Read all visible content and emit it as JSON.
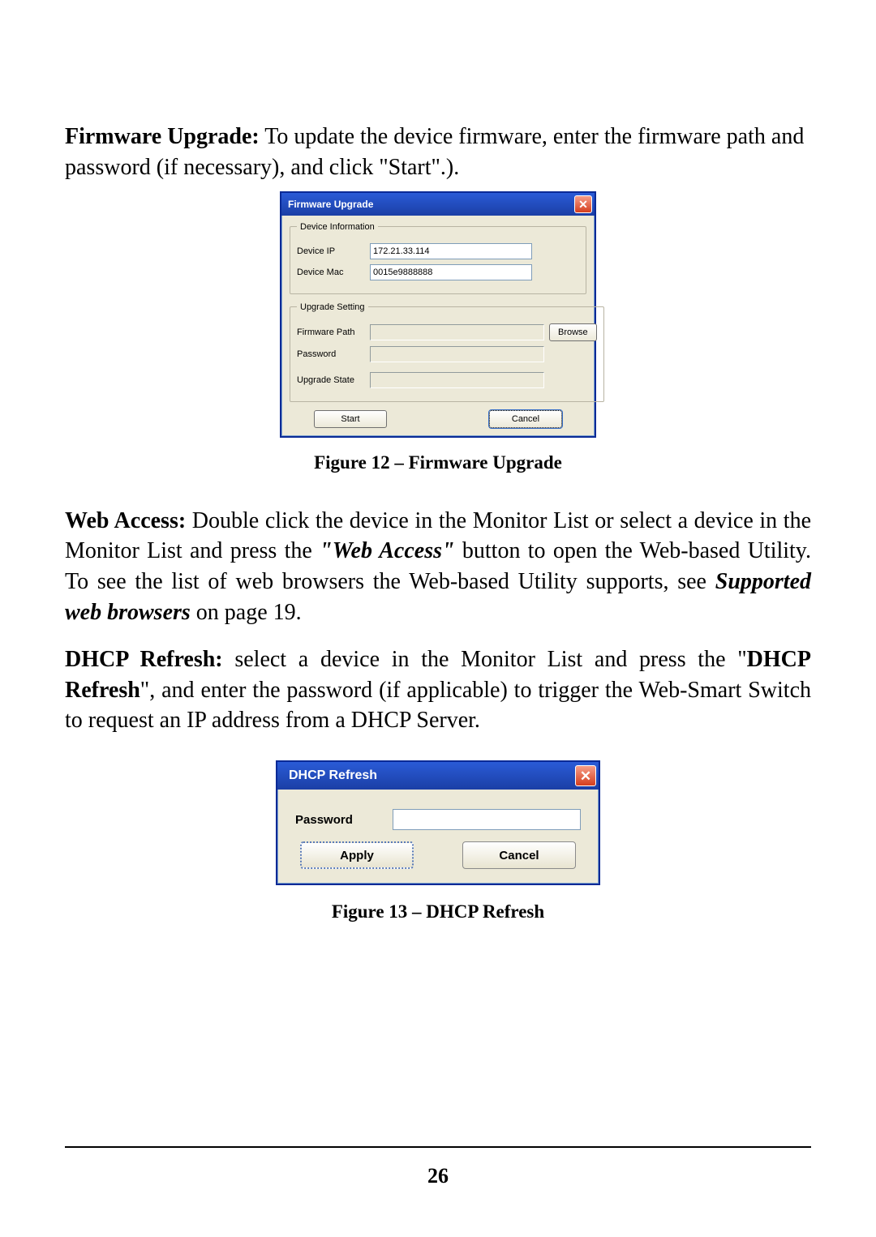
{
  "p1": {
    "heading": "Firmware Upgrade:",
    "text": " To update the device firmware, enter the firmware path and password (if necessary), and click \"Start\".)."
  },
  "fw": {
    "title": "Firmware Upgrade",
    "close": "✕",
    "groups": {
      "device": {
        "legend": "Device Information",
        "ip_label": "Device IP",
        "ip_value": "172.21.33.114",
        "mac_label": "Device Mac",
        "mac_value": "0015e9888888"
      },
      "upgrade": {
        "legend": "Upgrade Setting",
        "path_label": "Firmware Path",
        "browse_label": "Browse",
        "pwd_label": "Password",
        "state_label": "Upgrade State"
      }
    },
    "start_label": "Start",
    "cancel_label": "Cancel"
  },
  "caption1": "Figure 12 – Firmware Upgrade",
  "p2": {
    "heading": "Web Access:",
    "t1": " Double click the device in the Monitor List or select a device in the Monitor List and press the ",
    "em1": "\"Web Access\"",
    "t2": " button to open the Web-based Utility. To see the list of web browsers the Web-based Utility supports, see ",
    "em2": "Supported web browsers",
    "t3": " on page 19."
  },
  "p3": {
    "heading": "DHCP Refresh:",
    "t1": " select a device in the Monitor List and press the \"",
    "strong1": "DHCP Refresh",
    "t2": "\", and enter the password (if applicable) to trigger the Web-Smart Switch to request an IP address from a DHCP Server."
  },
  "dhcp": {
    "title": "DHCP Refresh",
    "close": "✕",
    "pwd_label": "Password",
    "apply_label": "Apply",
    "cancel_label": "Cancel"
  },
  "caption2": "Figure 13 – DHCP Refresh",
  "page_number": "26"
}
